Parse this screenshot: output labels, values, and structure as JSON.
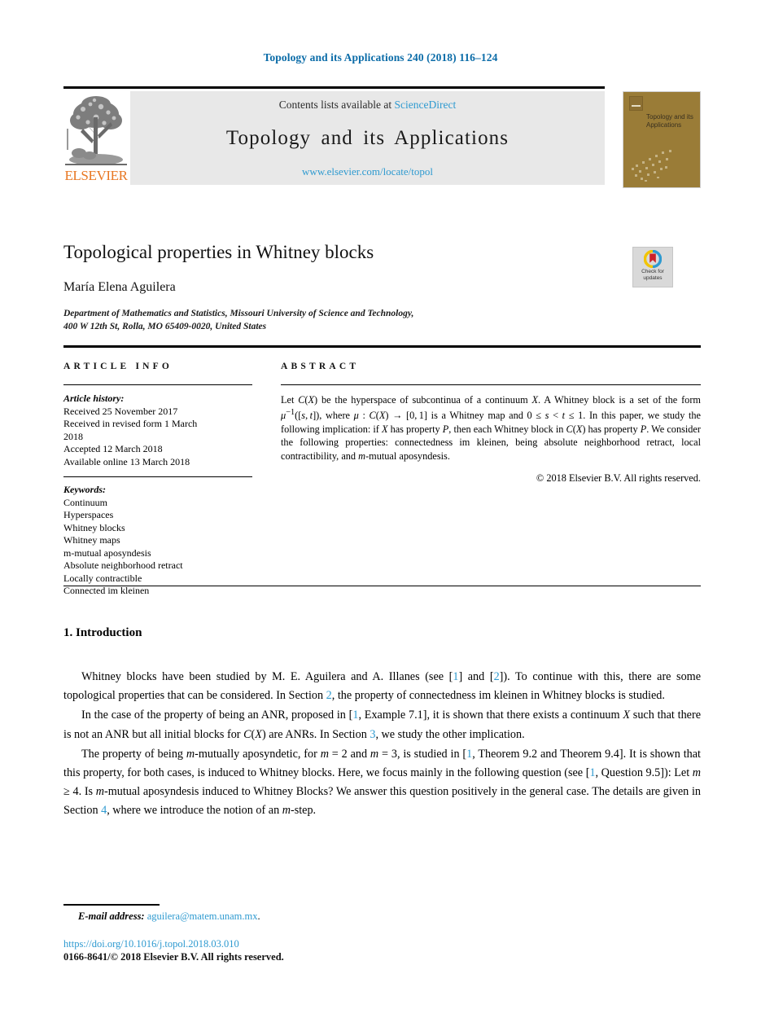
{
  "running_head": "Topology and its Applications 240 (2018) 116–124",
  "masthead": {
    "publisher_wordmark": "ELSEVIER",
    "contents_prefix": "Contents lists available at ",
    "contents_link": "ScienceDirect",
    "journal_title": "Topology and its Applications",
    "journal_url": "www.elsevier.com/locate/topol",
    "cover_title": "Topology and its Applications"
  },
  "article": {
    "title": "Topological properties in Whitney blocks",
    "author": "María Elena Aguilera",
    "affiliation_line1": "Department of Mathematics and Statistics, Missouri University of Science and Technology,",
    "affiliation_line2": "400 W 12th St, Rolla, MO 65409-0020, United States"
  },
  "crossmark": {
    "line1": "Check for",
    "line2": "updates"
  },
  "info": {
    "heading": "ARTICLE INFO",
    "history_label": "Article history:",
    "history": [
      "Received 25 November 2017",
      "Received in revised form 1 March",
      "2018",
      "Accepted 12 March 2018",
      "Available online 13 March 2018"
    ],
    "keywords_label": "Keywords:",
    "keywords": [
      "Continuum",
      "Hyperspaces",
      "Whitney blocks",
      "Whitney maps",
      "m-mutual aposyndesis",
      "Absolute neighborhood retract",
      "Locally contractible",
      "Connected im kleinen"
    ]
  },
  "abstract": {
    "heading": "ABSTRACT",
    "copyright": "© 2018 Elsevier B.V. All rights reserved."
  },
  "introduction": {
    "heading": "1. Introduction"
  },
  "footer": {
    "email_label": "E-mail address:",
    "email": "aguilera@matem.unam.mx",
    "email_period": ".",
    "doi": "https://doi.org/10.1016/j.topol.2018.03.010",
    "issn": "0166-8641/© 2018 Elsevier B.V. All rights reserved."
  },
  "colors": {
    "link_blue": "#2e9ad0",
    "running_head_blue": "#0b6ca8",
    "elsevier_orange": "#e87722",
    "cover_gold": "#9a7c37",
    "band_gray": "#e8e8e8"
  }
}
